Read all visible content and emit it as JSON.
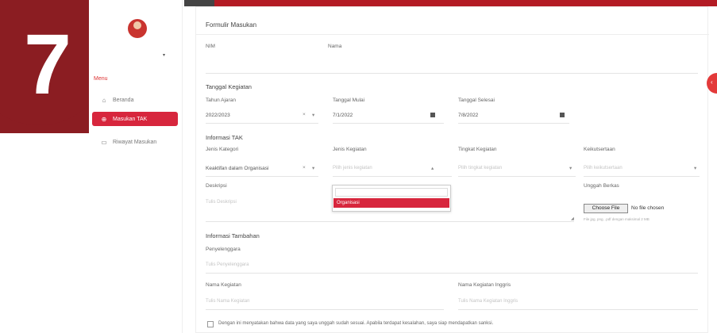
{
  "step": "7",
  "sidebar": {
    "menu_title": "Menu",
    "items": [
      {
        "label": "Beranda",
        "icon": "home-icon"
      },
      {
        "label": "Masukan TAK",
        "icon": "plus-circle-icon"
      },
      {
        "label": "Riwayat Masukan",
        "icon": "folder-icon"
      }
    ]
  },
  "form": {
    "title": "Formulir Masukan",
    "nim_label": "NIM",
    "nama_label": "Nama",
    "tanggal_section": "Tanggal Kegiatan",
    "tahun_ajaran_label": "Tahun Ajaran",
    "tahun_ajaran_value": "2022/2023",
    "tanggal_mulai_label": "Tanggal Mulai",
    "tanggal_mulai_value": "7/1/2022",
    "tanggal_selesai_label": "Tanggal Selesai",
    "tanggal_selesai_value": "7/8/2022",
    "info_tak_section": "Informasi TAK",
    "jenis_kategori_label": "Jenis Kategori",
    "jenis_kategori_value": "Keaktifan dalam Organisasi",
    "jenis_kegiatan_label": "Jenis Kegiatan",
    "jenis_kegiatan_placeholder": "Pilih jenis kegiatan",
    "tingkat_kegiatan_label": "Tingkat Kegiatan",
    "tingkat_kegiatan_placeholder": "Pilih tingkat kegiatan",
    "keikutsertaan_label": "Keikutsertaan",
    "keikutsertaan_placeholder": "Pilih keikutsertaan",
    "deskripsi_label": "Deskripsi",
    "deskripsi_placeholder": "Tulis Deskripsi",
    "dropdown_option": "Organisasi",
    "unggah_label": "Unggah Berkas",
    "file_button": "Choose File",
    "file_status": "No file chosen",
    "file_hint": "File jpg, png, .pdf dengan maksimal 2 MB",
    "info_tambahan_section": "Informasi Tambahan",
    "penyelenggara_label": "Penyelenggara",
    "penyelenggara_placeholder": "Tulis Penyelenggara",
    "nama_kegiatan_label": "Nama Kegiatan",
    "nama_kegiatan_placeholder": "Tulis Nama Kegiatan",
    "nama_kegiatan_inggris_label": "Nama Kegiatan Inggris",
    "nama_kegiatan_inggris_placeholder": "Tulis Nama Kegiatan Inggris",
    "consent": "Dengan ini menyatakan bahwa data yang saya unggah sudah sesuai. Apabila terdapat kesalahan, saya siap mendapatkan sanksi."
  },
  "colors": {
    "brand": "#d7263d",
    "badge": "#8b1d22"
  }
}
